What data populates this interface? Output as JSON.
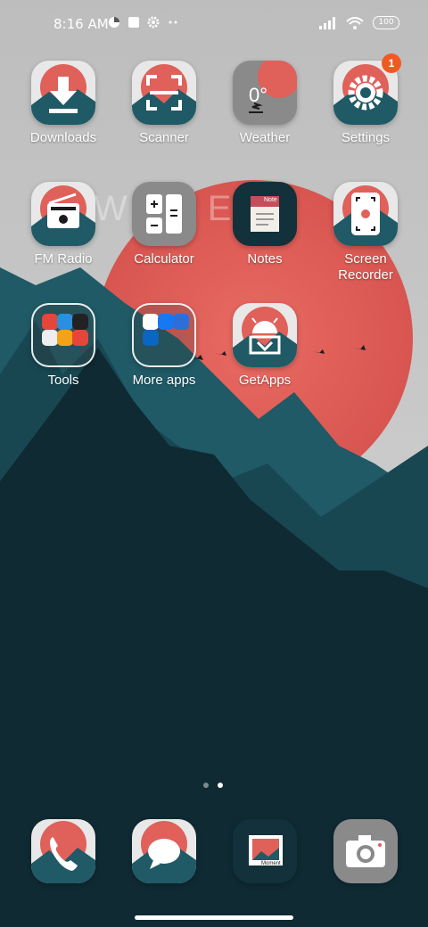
{
  "status": {
    "time": "8:16 AM",
    "battery": "100",
    "icons": [
      "data-saver-icon",
      "square-notification-icon",
      "gear-icon",
      "more-dots-icon",
      "signal-icon",
      "wifi-icon",
      "battery-icon"
    ]
  },
  "background_text": "WE O EN",
  "apps_row1": [
    {
      "label": "Downloads",
      "icon": "download-icon"
    },
    {
      "label": "Scanner",
      "icon": "scanner-icon"
    },
    {
      "label": "Weather",
      "icon": "weather-icon",
      "temp": "0°"
    },
    {
      "label": "Settings",
      "icon": "gear-icon",
      "badge": "1"
    }
  ],
  "apps_row2": [
    {
      "label": "FM Radio",
      "icon": "radio-icon"
    },
    {
      "label": "Calculator",
      "icon": "calculator-icon"
    },
    {
      "label": "Notes",
      "icon": "notes-icon",
      "note_tag": "Note"
    },
    {
      "label": "Screen\nRecorder",
      "icon": "screen-recorder-icon"
    }
  ],
  "apps_row3": [
    {
      "label": "Tools",
      "icon": "folder-icon"
    },
    {
      "label": "More apps",
      "icon": "folder-icon"
    },
    {
      "label": "GetApps",
      "icon": "getapps-icon"
    }
  ],
  "page_indicator": {
    "count": 2,
    "active": 2
  },
  "dock": [
    {
      "name": "phone",
      "icon": "phone-icon"
    },
    {
      "name": "messages",
      "icon": "message-icon"
    },
    {
      "name": "gallery",
      "icon": "gallery-icon",
      "caption": "Moment"
    },
    {
      "name": "camera",
      "icon": "camera-icon"
    }
  ],
  "colors": {
    "sun": "#e0605a",
    "mountain_dark": "#0f2a33",
    "mountain_teal": "#1f5a66",
    "sky": "#c9c9c9",
    "badge": "#f05a22"
  }
}
